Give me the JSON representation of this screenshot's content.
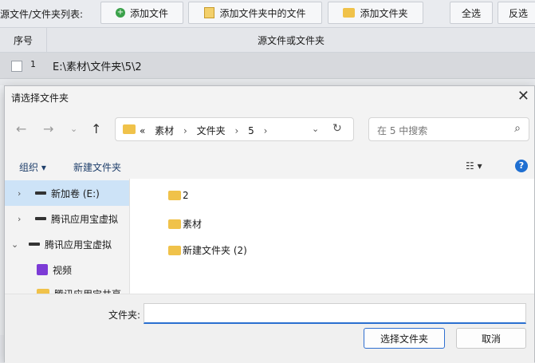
{
  "app": {
    "list_label": "源文件/文件夹列表:",
    "toolbar": {
      "add_file": "添加文件",
      "add_files_in_folder": "添加文件夹中的文件",
      "add_folder": "添加文件夹",
      "select_all": "全选",
      "invert": "反选"
    },
    "grid": {
      "col_index": "序号",
      "col_source": "源文件或文件夹",
      "rows": [
        {
          "index": "1",
          "path": "E:\\素材\\文件夹\\5\\2"
        }
      ]
    }
  },
  "dialog": {
    "title": "请选择文件夹",
    "address": {
      "prefix": "«",
      "crumbs": [
        "素材",
        "文件夹",
        "5"
      ]
    },
    "search_placeholder": "在 5 中搜索",
    "commands": {
      "organize": "组织 ▾",
      "new_folder": "新建文件夹"
    },
    "tree": [
      {
        "label": "新加卷 (E:)",
        "selected": true,
        "expanded": false
      },
      {
        "label": "腾讯应用宝虚拟",
        "selected": false,
        "expanded": false
      },
      {
        "label": "腾讯应用宝虚拟",
        "selected": false,
        "expanded": true
      },
      {
        "label": "视频",
        "selected": false
      },
      {
        "label": "腾讯应用宝共享",
        "selected": false
      }
    ],
    "items": [
      "2",
      "素材",
      "新建文件夹 (2)"
    ],
    "folder_label": "文件夹:",
    "folder_value": "",
    "select_button": "选择文件夹",
    "cancel_button": "取消",
    "colors": {
      "accent": "#2a6fd0",
      "folder": "#f0c24a",
      "tree_selected": "#cde3f7"
    }
  }
}
